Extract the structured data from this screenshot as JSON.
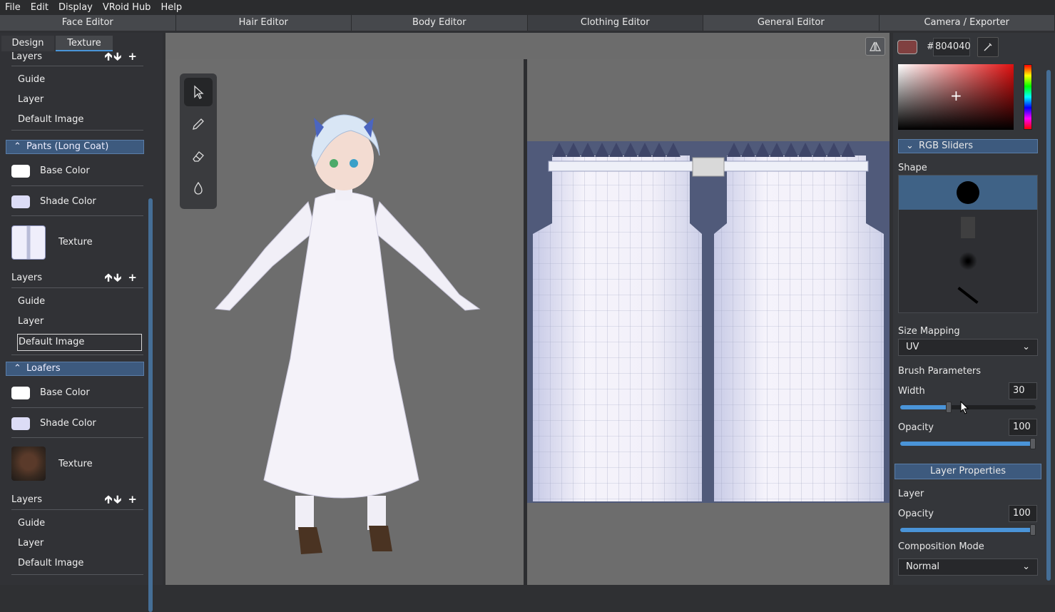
{
  "menu": [
    "File",
    "Edit",
    "Display",
    "VRoid Hub",
    "Help"
  ],
  "editor_tabs": [
    "Face Editor",
    "Hair Editor",
    "Body Editor",
    "Clothing Editor",
    "General Editor",
    "Camera / Exporter"
  ],
  "active_editor": "Clothing Editor",
  "side_tabs": {
    "design": "Design",
    "texture": "Texture",
    "active": "Texture"
  },
  "left_panel": {
    "top_layers": {
      "label": "Layers",
      "items": [
        "Guide",
        "Layer",
        "Default Image"
      ]
    },
    "sections": [
      {
        "title": "Pants (Long Coat)",
        "base_color": "Base Color",
        "shade_color": "Shade Color",
        "texture": "Texture",
        "layers_label": "Layers",
        "layers": [
          "Guide",
          "Layer",
          "Default Image"
        ],
        "selected_layer": "Default Image"
      },
      {
        "title": "Loafers",
        "base_color": "Base Color",
        "shade_color": "Shade Color",
        "texture": "Texture",
        "layers_label": "Layers",
        "layers": [
          "Guide",
          "Layer",
          "Default Image"
        ]
      }
    ]
  },
  "tools": [
    "select-tool",
    "pen-tool",
    "eraser-tool",
    "fill-tool"
  ],
  "right_panel": {
    "color_hex_prefix": "#",
    "color_hex": "804040",
    "color_value": "#804040",
    "rgb_sliders_label": "RGB Sliders",
    "shape_label": "Shape",
    "size_mapping_label": "Size Mapping",
    "size_mapping_value": "UV",
    "brush_params_label": "Brush Parameters",
    "width_label": "Width",
    "width_value": "30",
    "width_fraction": 0.36,
    "opacity_label": "Opacity",
    "opacity_value": "100",
    "opacity_fraction": 1.0,
    "layer_props_label": "Layer Properties",
    "layer_label": "Layer",
    "layer_opacity_label": "Opacity",
    "layer_opacity_value": "100",
    "layer_opacity_fraction": 1.0,
    "composition_label": "Composition Mode",
    "composition_value": "Normal"
  },
  "colors": {
    "accent": "#4a94d8",
    "section_header": "#3d5a7e",
    "shade_swatch": "#dcdcf6"
  }
}
